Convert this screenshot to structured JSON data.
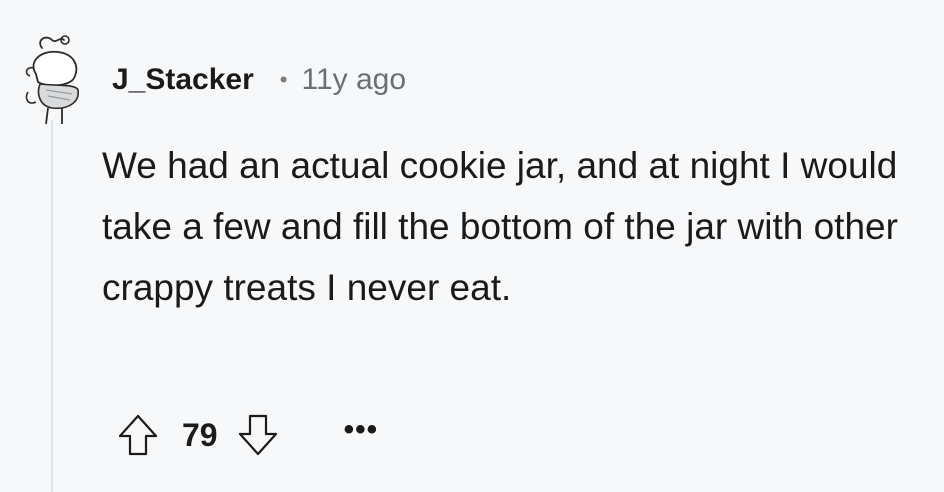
{
  "comment": {
    "author": "J_Stacker",
    "separator": "•",
    "timestamp": "11y ago",
    "body": "We had an actual cookie jar, and at night I would take a few and fill the bottom of the jar with other crappy treats I never eat.",
    "score": "79",
    "more_label": "•••",
    "avatar_icon": "snoo-avatar-icon",
    "upvote_icon": "arrow-up-icon",
    "downvote_icon": "arrow-down-icon"
  }
}
